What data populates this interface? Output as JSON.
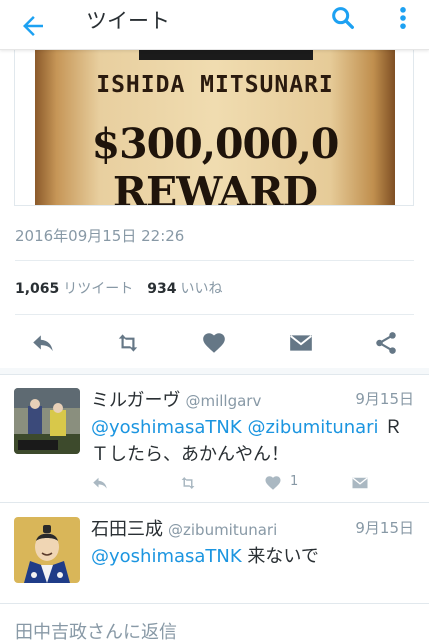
{
  "header": {
    "title": "ツイート"
  },
  "tweet": {
    "poster": {
      "name_text": "ISHIDA MITSUNARI",
      "reward_text": "$300,000,0 REWARD"
    },
    "timestamp": "2016年09月15日 22:26",
    "retweet_count": "1,065",
    "retweet_label": "リツイート",
    "like_count": "934",
    "like_label": "いいね"
  },
  "replies": [
    {
      "display_name": "ミルガーヴ",
      "handle": "@millgarv",
      "date": "9月15日",
      "mention1": "@yoshimasaTNK",
      "mention2": "@zibumitunari",
      "text": " ＲＴしたら、あかんやん！",
      "like_count": "1"
    },
    {
      "display_name": "石田三成",
      "handle": "@zibumitunari",
      "date": "9月15日",
      "mention1": "@yoshimasaTNK",
      "text": " 来ないで"
    }
  ],
  "composer": {
    "placeholder": "田中吉政さんに返信"
  },
  "colors": {
    "accent": "#1da1f2",
    "mention": "#1b95e0",
    "muted": "#8899a6",
    "action_icon": "#657786"
  }
}
